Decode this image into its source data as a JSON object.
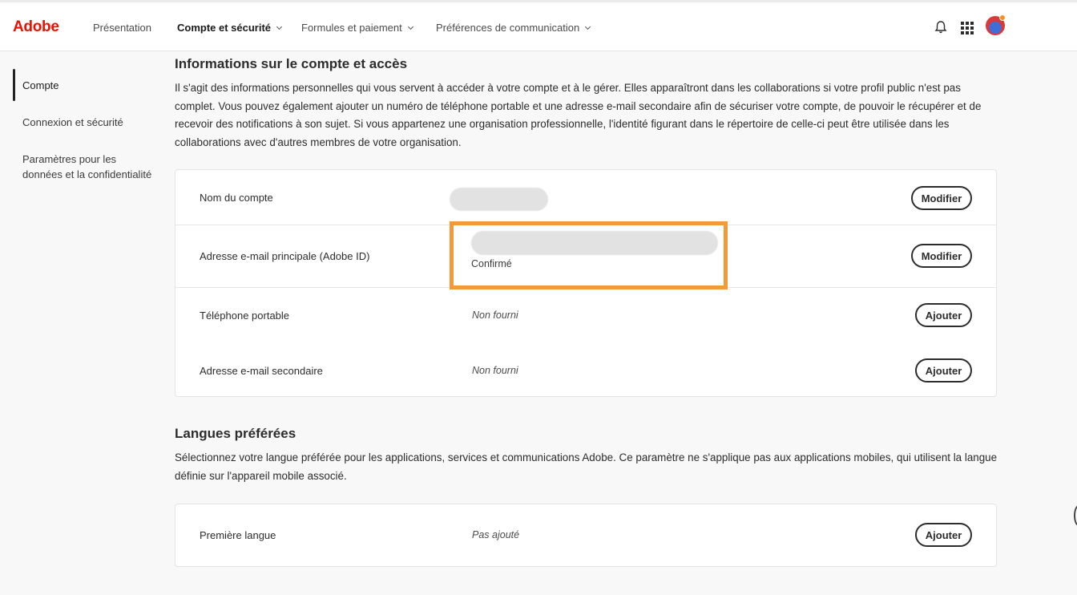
{
  "header": {
    "logo": "Adobe",
    "nav": [
      {
        "label": "Présentation"
      },
      {
        "label": "Compte et sécurité"
      },
      {
        "label": "Formules et paiement"
      },
      {
        "label": "Préférences de communication"
      }
    ]
  },
  "sidebar": {
    "items": [
      {
        "label": "Compte"
      },
      {
        "label": "Connexion et sécurité"
      },
      {
        "label": "Paramètres pour les données et la confidentialité"
      }
    ]
  },
  "account": {
    "title": "Informations sur le compte et accès",
    "description": "Il s'agit des informations personnelles qui vous servent à accéder à votre compte et à le gérer. Elles apparaîtront dans les collaborations si votre profil public n'est pas complet. Vous pouvez également ajouter un numéro de téléphone portable et une adresse e-mail secondaire afin de sécuriser votre compte, de pouvoir le récupérer et de recevoir des notifications à son sujet. Si vous appartenez une organisation professionnelle, l'identité figurant dans le répertoire de celle-ci peut être utilisée dans les collaborations avec d'autres membres de votre organisation.",
    "rows": [
      {
        "label": "Nom du compte",
        "value": "",
        "button": "Modifier"
      },
      {
        "label": "Adresse e-mail principale (Adobe ID)",
        "value": "",
        "status": "Confirmé",
        "button": "Modifier"
      },
      {
        "label": "Téléphone portable",
        "value": "Non fourni",
        "button": "Ajouter"
      },
      {
        "label": "Adresse e-mail secondaire",
        "value": "Non fourni",
        "button": "Ajouter"
      }
    ]
  },
  "languages": {
    "title": "Langues préférées",
    "description": "Sélectionnez votre langue préférée pour les applications, services et communications Adobe. Ce paramètre ne s'applique pas aux applications mobiles, qui utilisent la langue définie sur l'appareil mobile associé.",
    "rows": [
      {
        "label": "Première langue",
        "value": "Pas ajouté",
        "button": "Ajouter"
      }
    ]
  },
  "colors": {
    "brand": "#eb1000",
    "highlight": "#f29a38"
  }
}
